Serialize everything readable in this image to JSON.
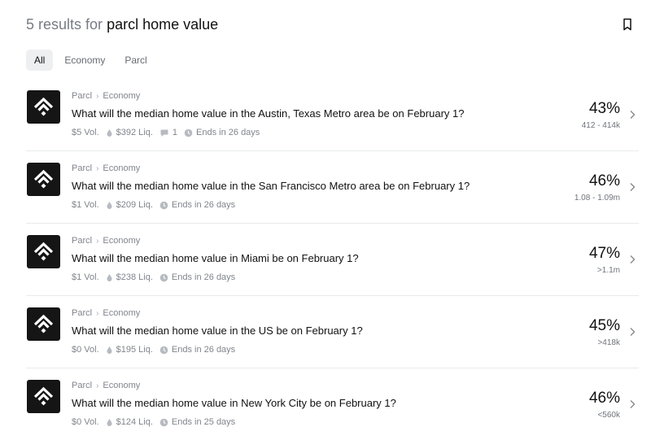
{
  "header": {
    "count_text": "5 results for",
    "query": "parcl home value"
  },
  "tabs": [
    {
      "label": "All",
      "active": true
    },
    {
      "label": "Economy",
      "active": false
    },
    {
      "label": "Parcl",
      "active": false
    }
  ],
  "results": [
    {
      "source": "Parcl",
      "category": "Economy",
      "question": "What will the median home value in the Austin, Texas Metro area be on February 1?",
      "vol": "$5 Vol.",
      "liq": "$392 Liq.",
      "comments": "1",
      "ends": "Ends in 26 days",
      "percent": "43%",
      "range": "412 - 414k"
    },
    {
      "source": "Parcl",
      "category": "Economy",
      "question": "What will the median home value in the San Francisco Metro area be on February 1?",
      "vol": "$1 Vol.",
      "liq": "$209 Liq.",
      "comments": null,
      "ends": "Ends in 26 days",
      "percent": "46%",
      "range": "1.08 - 1.09m"
    },
    {
      "source": "Parcl",
      "category": "Economy",
      "question": "What will the median home value in Miami be on February 1?",
      "vol": "$1 Vol.",
      "liq": "$238 Liq.",
      "comments": null,
      "ends": "Ends in 26 days",
      "percent": "47%",
      "range": ">1.1m"
    },
    {
      "source": "Parcl",
      "category": "Economy",
      "question": "What will the median home value in the US be on February 1?",
      "vol": "$0 Vol.",
      "liq": "$195 Liq.",
      "comments": null,
      "ends": "Ends in 26 days",
      "percent": "45%",
      "range": ">418k"
    },
    {
      "source": "Parcl",
      "category": "Economy",
      "question": "What will the median home value in New York City be on February 1?",
      "vol": "$0 Vol.",
      "liq": "$124 Liq.",
      "comments": null,
      "ends": "Ends in 25 days",
      "percent": "46%",
      "range": "<560k"
    }
  ],
  "colors": {
    "logo_bg": "#151515",
    "muted": "#80858c",
    "divider": "#e9eaec"
  }
}
